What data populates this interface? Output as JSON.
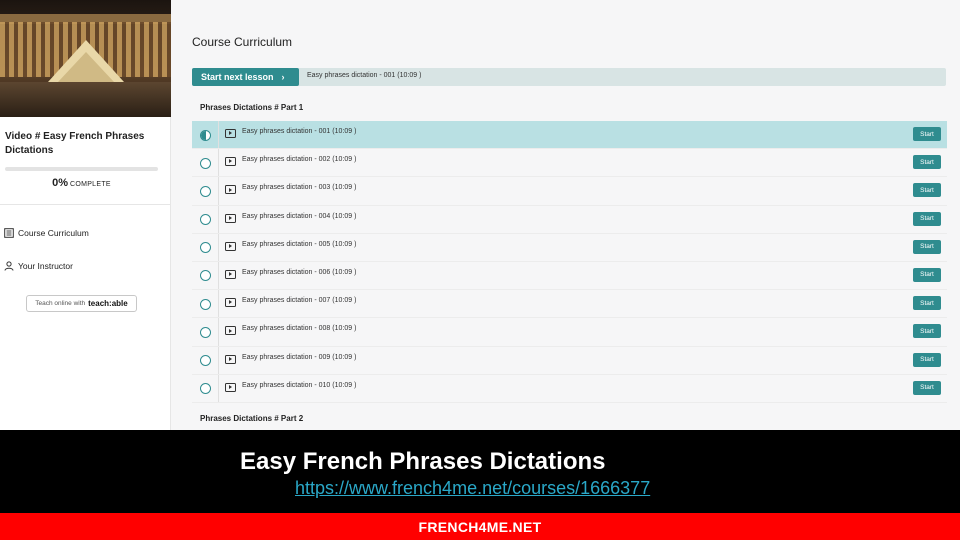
{
  "sidebar": {
    "course_title": "Video # Easy French Phrases Dictations",
    "progress": {
      "percent_label": "0%",
      "complete_label": "COMPLETE",
      "fraction": 0
    },
    "nav": [
      {
        "label": "Course Curriculum",
        "icon": "curriculum-icon"
      },
      {
        "label": "Your Instructor",
        "icon": "user-icon"
      }
    ],
    "teach_badge": {
      "prefix": "Teach online with",
      "brand": "teach:able"
    }
  },
  "main": {
    "title": "Course Curriculum",
    "next_lesson": {
      "button_label": "Start next lesson",
      "lesson_label": "Easy phrases dictation - 001 (10:09 )"
    },
    "sections": [
      {
        "title": "Phrases Dictations # Part 1",
        "lessons": [
          {
            "name": "Easy phrases dictation - 001 (10:09 )",
            "button": "Start",
            "active": true
          },
          {
            "name": "Easy phrases dictation - 002 (10:09 )",
            "button": "Start"
          },
          {
            "name": "Easy phrases dictation - 003 (10:09 )",
            "button": "Start"
          },
          {
            "name": "Easy phrases dictation - 004 (10:09 )",
            "button": "Start"
          },
          {
            "name": "Easy phrases dictation - 005 (10:09 )",
            "button": "Start"
          },
          {
            "name": "Easy phrases dictation - 006 (10:09 )",
            "button": "Start"
          },
          {
            "name": "Easy phrases dictation - 007 (10:09 )",
            "button": "Start"
          },
          {
            "name": "Easy phrases dictation - 008 (10:09 )",
            "button": "Start"
          },
          {
            "name": "Easy phrases dictation - 009 (10:09 )",
            "button": "Start"
          },
          {
            "name": "Easy phrases dictation - 010 (10:09 )",
            "button": "Start"
          }
        ]
      },
      {
        "title": "Phrases Dictations # Part 2",
        "lessons": []
      }
    ]
  },
  "banner": {
    "title": "Easy French Phrases Dictations",
    "url": "https://www.french4me.net/courses/1666377",
    "footer": "FRENCH4ME.NET"
  },
  "colors": {
    "accent": "#2f8c8f",
    "active_row": "#b9e0e3",
    "banner_red": "#ff0000",
    "link": "#2aa8c8"
  }
}
